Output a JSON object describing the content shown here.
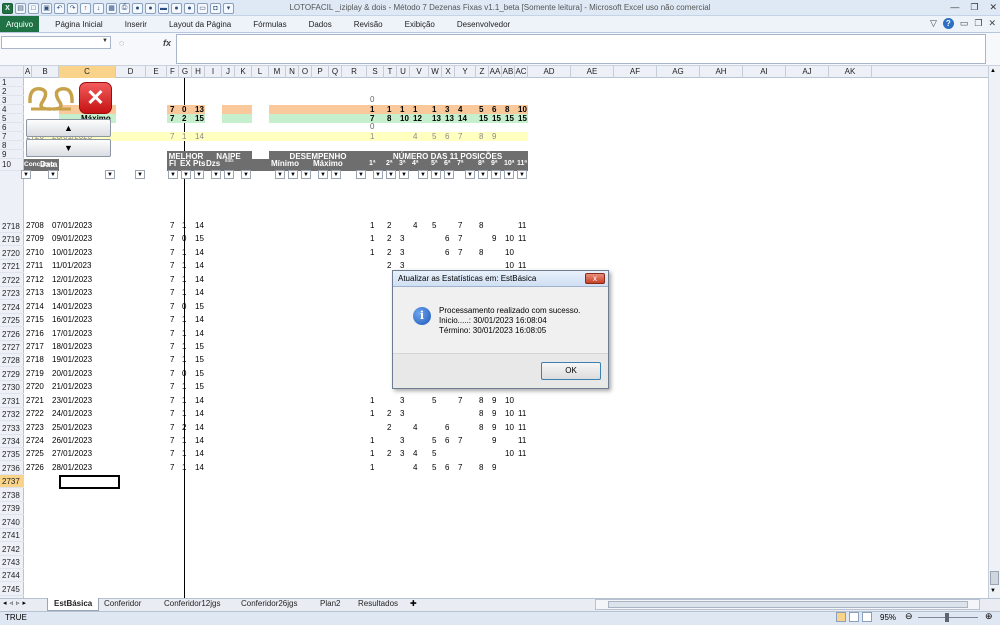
{
  "window": {
    "title": "LOTOFACIL _iziplay & dois - Método 7 Dezenas Fixas v1.1_beta  [Somente leitura]  -  Microsoft Excel uso não comercial"
  },
  "ribbon": {
    "tabs": [
      "Arquivo",
      "Página Inicial",
      "Inserir",
      "Layout da Página",
      "Fórmulas",
      "Dados",
      "Revisão",
      "Exibição",
      "Desenvolvedor"
    ]
  },
  "formula": {
    "fx": "fx",
    "name_value": "",
    "content": ""
  },
  "columns": [
    "A",
    "B",
    "C",
    "D",
    "E",
    "F",
    "G",
    "H",
    "I",
    "J",
    "K",
    "L",
    "M",
    "N",
    "O",
    "P",
    "Q",
    "R",
    "S",
    "T",
    "U",
    "V",
    "W",
    "X",
    "Y",
    "Z",
    "AA",
    "AB",
    "AC",
    "AD",
    "AE",
    "AF",
    "AG",
    "AH",
    "AI",
    "AJ",
    "AK"
  ],
  "rows": [
    "1",
    "2",
    "3",
    "4",
    "5",
    "6",
    "7",
    "8",
    "9",
    "10",
    "2718",
    "2719",
    "2720",
    "2721",
    "2722",
    "2723",
    "2724",
    "2725",
    "2726",
    "2727",
    "2728",
    "2729",
    "2730",
    "2731",
    "2732",
    "2733",
    "2734",
    "2735",
    "2736",
    "2737",
    "2738",
    "2739",
    "2740",
    "2741",
    "2742",
    "2743",
    "2744",
    "2745",
    "2746"
  ],
  "sheet": {
    "minimo_label": "Mínimo",
    "maximo_label": "Máximo",
    "min_vals": [
      "7",
      "0",
      "13"
    ],
    "max_vals": [
      "7",
      "2",
      "15"
    ],
    "row3_zero": "0",
    "row6_zero": "0",
    "pos_min": [
      "1",
      "1",
      "1",
      "1",
      "1",
      "3",
      "4",
      "5",
      "6",
      "8",
      "10"
    ],
    "pos_max": [
      "7",
      "8",
      "10",
      "12",
      "13",
      "13",
      "14",
      "15",
      "15",
      "15",
      "15"
    ],
    "row7": {
      "conc": "2726",
      "date": "28/01/2023",
      "fi": "7",
      "ex": "1",
      "pts": "14",
      "pos": [
        "1",
        "",
        "",
        "4",
        "5",
        "6",
        "7",
        "8",
        "9",
        "",
        ""
      ]
    },
    "row9_conc": "2726",
    "grp_melhor": "MELHOR",
    "grp_naipe": "NAIPE",
    "grp_desemp": "DESEMPENHO",
    "grp_num": "NÚMERO  DAS 11 POSIÇÕES",
    "h_concurso": "Concurso",
    "h_data": "Data Sorteio",
    "h_fi": "FI",
    "h_ex": "EX",
    "h_pts": "Pts",
    "h_dzs": "Dzs",
    "h_naipe_small": "ilais",
    "h_min": "Mínimo",
    "h_max": "Máximo",
    "pos_headers": [
      "1ª",
      "2ª",
      "3ª",
      "4ª",
      "5ª",
      "6ª",
      "7ª",
      "8ª",
      "9ª",
      "10ª",
      "11ª"
    ],
    "data_rows": [
      {
        "conc": "2708",
        "date": "07/01/2023",
        "fi": "7",
        "ex": "1",
        "pts": "14",
        "pos": [
          "1",
          "2",
          "",
          "4",
          "5",
          "",
          "7",
          "8",
          "",
          "",
          "11"
        ]
      },
      {
        "conc": "2709",
        "date": "09/01/2023",
        "fi": "7",
        "ex": "0",
        "pts": "15",
        "pos": [
          "1",
          "2",
          "3",
          "",
          "",
          "6",
          "7",
          "",
          "9",
          "10",
          "11"
        ]
      },
      {
        "conc": "2710",
        "date": "10/01/2023",
        "fi": "7",
        "ex": "1",
        "pts": "14",
        "pos": [
          "1",
          "2",
          "3",
          "",
          "",
          "6",
          "7",
          "8",
          "",
          "10",
          ""
        ]
      },
      {
        "conc": "2711",
        "date": "11/01/2023",
        "fi": "7",
        "ex": "1",
        "pts": "14",
        "pos": [
          "",
          "2",
          "3",
          "",
          "",
          "",
          "",
          "",
          "",
          "10",
          "11"
        ]
      },
      {
        "conc": "2712",
        "date": "12/01/2023",
        "fi": "7",
        "ex": "1",
        "pts": "14",
        "pos": [
          "",
          "",
          "",
          "",
          "",
          "",
          "",
          "",
          "",
          "",
          "11"
        ]
      },
      {
        "conc": "2713",
        "date": "13/01/2023",
        "fi": "7",
        "ex": "1",
        "pts": "14",
        "pos": [
          "",
          "",
          "",
          "",
          "",
          "",
          "",
          "",
          "",
          "10",
          ""
        ]
      },
      {
        "conc": "2714",
        "date": "14/01/2023",
        "fi": "7",
        "ex": "0",
        "pts": "15",
        "pos": [
          "",
          "",
          "",
          "",
          "",
          "",
          "",
          "",
          "",
          "10",
          "11"
        ]
      },
      {
        "conc": "2715",
        "date": "16/01/2023",
        "fi": "7",
        "ex": "1",
        "pts": "14",
        "pos": [
          "",
          "",
          "",
          "",
          "",
          "",
          "",
          "",
          "",
          "",
          "11"
        ]
      },
      {
        "conc": "2716",
        "date": "17/01/2023",
        "fi": "7",
        "ex": "1",
        "pts": "14",
        "pos": [
          "",
          "",
          "",
          "",
          "",
          "",
          "",
          "",
          "",
          "",
          ""
        ]
      },
      {
        "conc": "2717",
        "date": "18/01/2023",
        "fi": "7",
        "ex": "1",
        "pts": "15",
        "pos": [
          "",
          "",
          "",
          "",
          "",
          "",
          "",
          "",
          "",
          "",
          "11"
        ]
      },
      {
        "conc": "2718",
        "date": "19/01/2023",
        "fi": "7",
        "ex": "1",
        "pts": "15",
        "pos": [
          "",
          "",
          "",
          "",
          "",
          "",
          "",
          "",
          "",
          "10",
          "11"
        ]
      },
      {
        "conc": "2719",
        "date": "20/01/2023",
        "fi": "7",
        "ex": "0",
        "pts": "15",
        "pos": [
          "",
          "",
          "",
          "",
          "",
          "",
          "",
          "",
          "",
          "10",
          "11"
        ]
      },
      {
        "conc": "2720",
        "date": "21/01/2023",
        "fi": "7",
        "ex": "1",
        "pts": "15",
        "pos": [
          "",
          "",
          "",
          "",
          "",
          "",
          "",
          "",
          "",
          "10",
          "11"
        ]
      },
      {
        "conc": "2721",
        "date": "23/01/2023",
        "fi": "7",
        "ex": "1",
        "pts": "14",
        "pos": [
          "1",
          "",
          "3",
          "",
          "5",
          "",
          "7",
          "8",
          "9",
          "10",
          ""
        ]
      },
      {
        "conc": "2722",
        "date": "24/01/2023",
        "fi": "7",
        "ex": "1",
        "pts": "14",
        "pos": [
          "1",
          "2",
          "3",
          "",
          "",
          "",
          "",
          "8",
          "9",
          "10",
          "11"
        ]
      },
      {
        "conc": "2723",
        "date": "25/01/2023",
        "fi": "7",
        "ex": "2",
        "pts": "14",
        "pos": [
          "",
          "2",
          "",
          "4",
          "",
          "6",
          "",
          "8",
          "9",
          "10",
          "11"
        ]
      },
      {
        "conc": "2724",
        "date": "26/01/2023",
        "fi": "7",
        "ex": "1",
        "pts": "14",
        "pos": [
          "1",
          "",
          "3",
          "",
          "5",
          "6",
          "7",
          "",
          "9",
          "",
          "11"
        ]
      },
      {
        "conc": "2725",
        "date": "27/01/2023",
        "fi": "7",
        "ex": "1",
        "pts": "14",
        "pos": [
          "1",
          "2",
          "3",
          "4",
          "5",
          "",
          "",
          "",
          "",
          "10",
          "11"
        ]
      },
      {
        "conc": "2726",
        "date": "28/01/2023",
        "fi": "7",
        "ex": "1",
        "pts": "14",
        "pos": [
          "1",
          "",
          "",
          "4",
          "5",
          "6",
          "7",
          "8",
          "9",
          "",
          ""
        ]
      }
    ]
  },
  "sheet_tabs": [
    "EstBásica",
    "Conferidor",
    "Conferidor12jgs",
    "Conferidor26jgs",
    "Plan2",
    "Resultados"
  ],
  "status": {
    "ready": "TRUE",
    "zoom": "95%"
  },
  "dialog": {
    "title": "Atualizar as Estatísticas em: EstBásica",
    "line1": "Processamento realizado com sucesso.",
    "line2": "Inicio.....: 30/01/2023 16:08:04",
    "line3": "Término: 30/01/2023 16:08:05",
    "ok": "OK",
    "close": "x"
  },
  "colors": {
    "minimo_fill": "#f9c89b",
    "maximo_fill": "#c6efce",
    "row7_fill": "#ffffc0",
    "header_grey": "#6e6e6e",
    "excel_green": "#1f7244"
  }
}
